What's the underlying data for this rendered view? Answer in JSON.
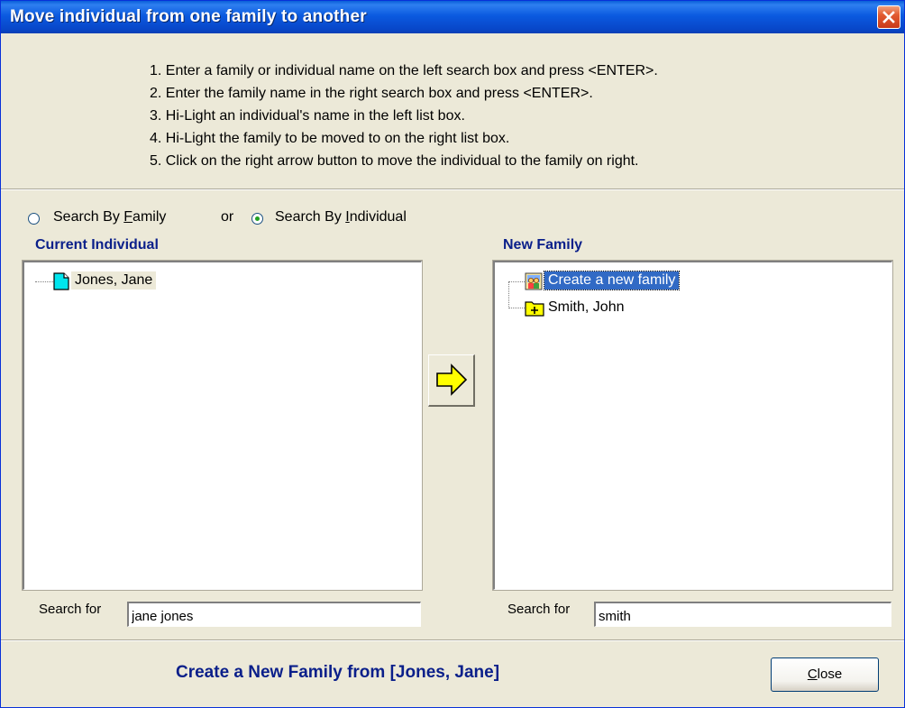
{
  "window": {
    "title": "Move individual from one family to another"
  },
  "instructions": [
    "1. Enter a family or individual name on the left search box and press <ENTER>.",
    "2. Enter the family name in the right search box and press <ENTER>.",
    "3. Hi-Light an individual's name in the left list box.",
    "4. Hi-Light the family to be moved to on the right list box.",
    "5. Click on the right arrow button to move  the individual to the family on right."
  ],
  "search_mode": {
    "option_family": {
      "prefix": "Search By ",
      "mnemonic": "F",
      "rest": "amily",
      "selected": false
    },
    "or_text": "or",
    "option_individual": {
      "prefix": "Search By ",
      "mnemonic": "I",
      "rest": "ndividual",
      "selected": true
    }
  },
  "left_panel": {
    "title": "Current Individual",
    "items": [
      {
        "label": "Jones, Jane",
        "icon": "document-icon",
        "selected": true
      }
    ],
    "search_label": "Search for",
    "search_value": "jane jones"
  },
  "right_panel": {
    "title": "New Family",
    "items": [
      {
        "label": "Create a new family",
        "icon": "family-icon",
        "selected": true
      },
      {
        "label": "Smith, John",
        "icon": "folder-plus-icon",
        "selected": false
      }
    ],
    "search_label": "Search for",
    "search_value": "smith"
  },
  "status_message": "Create a New Family from [Jones, Jane]",
  "close_button": {
    "mnemonic": "C",
    "rest": "lose"
  },
  "colors": {
    "titlebar": "#0b5ae0",
    "heading": "#0a1f8a",
    "selection": "#316ac5",
    "arrow": "#ffff00"
  }
}
